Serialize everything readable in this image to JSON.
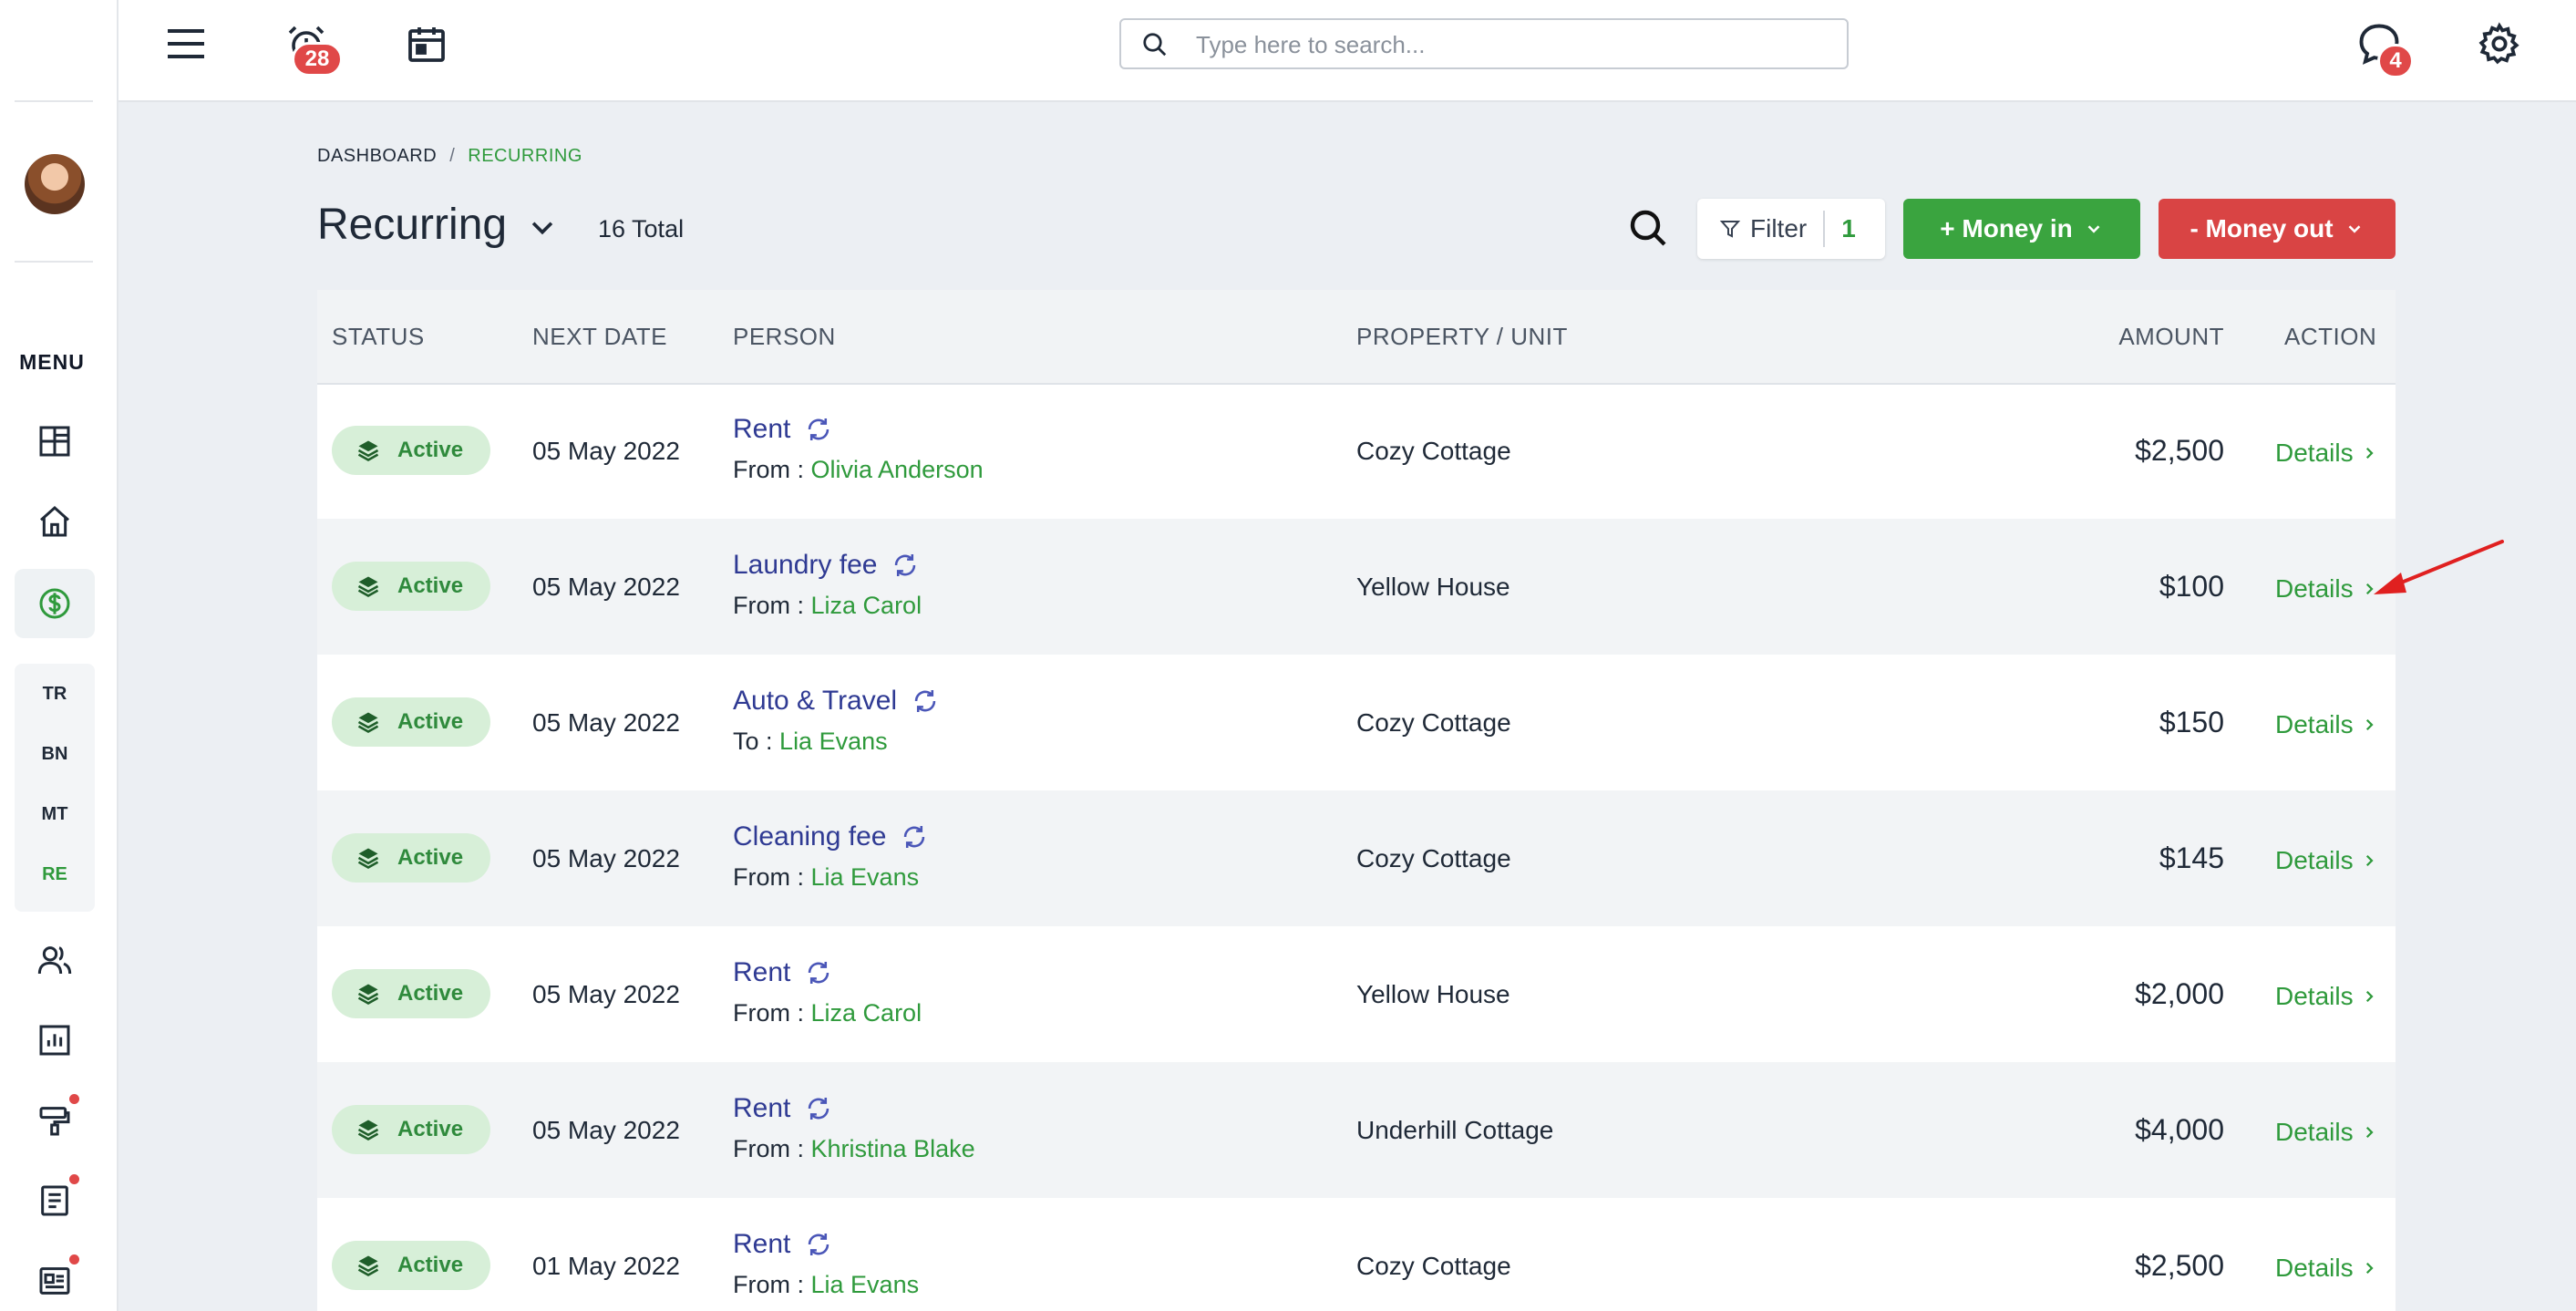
{
  "sidebar": {
    "menu_label": "MENU",
    "sub_items": [
      "TR",
      "BN",
      "MT",
      "RE"
    ],
    "active_sub": "RE"
  },
  "topbar": {
    "alarm_count": "28",
    "messages_count": "4",
    "search_placeholder": "Type here to search..."
  },
  "breadcrumb": {
    "root": "DASHBOARD",
    "separator": "/",
    "current": "RECURRING"
  },
  "header": {
    "title": "Recurring",
    "total": "16 Total",
    "filter_label": "Filter",
    "filter_count": "1",
    "money_in_label": "+ Money in",
    "money_out_label": "- Money out"
  },
  "table": {
    "columns": {
      "status": "STATUS",
      "next_date": "NEXT DATE",
      "person": "PERSON",
      "property": "PROPERTY / UNIT",
      "amount": "AMOUNT",
      "action": "ACTION"
    },
    "rows": [
      {
        "status": "Active",
        "date": "05 May 2022",
        "category": "Rent",
        "direction": "From :",
        "person": "Olivia Anderson",
        "property": "Cozy Cottage",
        "amount": "$2,500",
        "action": "Details"
      },
      {
        "status": "Active",
        "date": "05 May 2022",
        "category": "Laundry fee",
        "direction": "From :",
        "person": "Liza Carol",
        "property": "Yellow House",
        "amount": "$100",
        "action": "Details"
      },
      {
        "status": "Active",
        "date": "05 May 2022",
        "category": "Auto & Travel",
        "direction": "To :",
        "person": "Lia Evans",
        "property": "Cozy Cottage",
        "amount": "$150",
        "action": "Details"
      },
      {
        "status": "Active",
        "date": "05 May 2022",
        "category": "Cleaning fee",
        "direction": "From :",
        "person": "Lia Evans",
        "property": "Cozy Cottage",
        "amount": "$145",
        "action": "Details"
      },
      {
        "status": "Active",
        "date": "05 May 2022",
        "category": "Rent",
        "direction": "From :",
        "person": "Liza Carol",
        "property": "Yellow House",
        "amount": "$2,000",
        "action": "Details"
      },
      {
        "status": "Active",
        "date": "05 May 2022",
        "category": "Rent",
        "direction": "From :",
        "person": "Khristina Blake",
        "property": "Underhill Cottage",
        "amount": "$4,000",
        "action": "Details"
      },
      {
        "status": "Active",
        "date": "01 May 2022",
        "category": "Rent",
        "direction": "From :",
        "person": "Lia Evans",
        "property": "Cozy Cottage",
        "amount": "$2,500",
        "action": "Details"
      }
    ]
  },
  "colors": {
    "green": "#3aa43f",
    "red": "#d94444",
    "link_green": "#2f9a3c",
    "category_blue": "#2f3a93"
  }
}
